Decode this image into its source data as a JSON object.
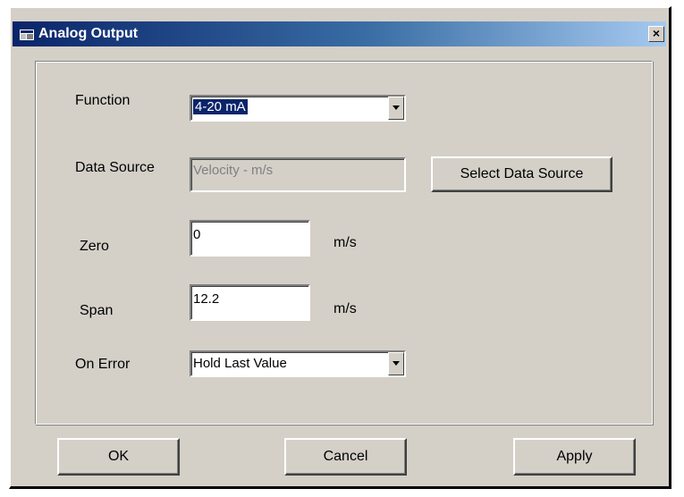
{
  "window": {
    "title": "Analog Output",
    "close_label": "×"
  },
  "form": {
    "function": {
      "label": "Function",
      "value": "4-20 mA"
    },
    "data_source": {
      "label": "Data Source",
      "value": "Velocity - m/s",
      "button_label": "Select Data Source"
    },
    "zero": {
      "label": "Zero",
      "value": "0",
      "unit": "m/s"
    },
    "span": {
      "label": "Span",
      "value": "12.2",
      "unit": "m/s"
    },
    "on_error": {
      "label": "On Error",
      "value": "Hold Last Value"
    }
  },
  "buttons": {
    "ok": "OK",
    "cancel": "Cancel",
    "apply": "Apply"
  },
  "colors": {
    "dialog_face": "#d4d0c8",
    "title_gradient_start": "#0a246a",
    "title_gradient_end": "#a6caf0",
    "selection": "#0a246a",
    "disabled_text": "#808080"
  },
  "icons": {
    "title": "window-app-icon",
    "combo_arrow": "chevron-down-icon"
  }
}
